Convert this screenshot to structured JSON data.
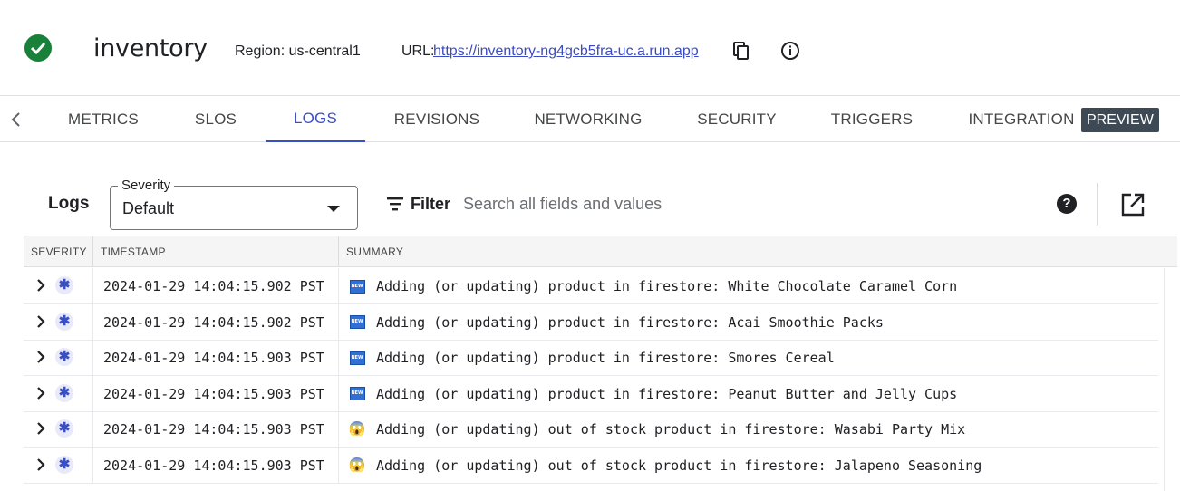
{
  "header": {
    "service_name": "inventory",
    "region": "Region: us-central1",
    "url_label": "URL:",
    "url": " https://inventory-ng4gcb5fra-uc.a.run.app ",
    "status": "healthy"
  },
  "tabs": [
    {
      "label": "METRICS"
    },
    {
      "label": "SLOS"
    },
    {
      "label": "LOGS",
      "active": true
    },
    {
      "label": "REVISIONS"
    },
    {
      "label": "NETWORKING"
    },
    {
      "label": "SECURITY"
    },
    {
      "label": "TRIGGERS"
    },
    {
      "label": "INTEGRATION"
    }
  ],
  "preview_badge": "PREVIEW",
  "logs": {
    "title": "Logs",
    "severity_label": "Severity",
    "severity_value": "Default",
    "filter_label": "Filter",
    "search_placeholder": "Search all fields and values",
    "help_glyph": "?"
  },
  "table": {
    "headers": [
      "SEVERITY",
      "TIMESTAMP",
      "SUMMARY"
    ],
    "rows": [
      {
        "timestamp": "2024-01-29 14:04:15.902 PST",
        "icon": "new-icon",
        "summary": "Adding (or updating) product in firestore: White Chocolate Caramel Corn"
      },
      {
        "timestamp": "2024-01-29 14:04:15.902 PST",
        "icon": "new-icon",
        "summary": "Adding (or updating) product in firestore: Acai Smoothie Packs"
      },
      {
        "timestamp": "2024-01-29 14:04:15.903 PST",
        "icon": "new-icon",
        "summary": "Adding (or updating) product in firestore: Smores Cereal"
      },
      {
        "timestamp": "2024-01-29 14:04:15.903 PST",
        "icon": "new-icon",
        "summary": "Adding (or updating) product in firestore: Peanut Butter and Jelly Cups"
      },
      {
        "timestamp": "2024-01-29 14:04:15.903 PST",
        "icon": "scream-icon",
        "summary": "Adding (or updating) out of stock product in firestore: Wasabi Party Mix"
      },
      {
        "timestamp": "2024-01-29 14:04:15.903 PST",
        "icon": "scream-icon",
        "summary": "Adding (or updating) out of stock product in firestore: Jalapeno Seasoning"
      }
    ]
  },
  "icons": {
    "new_glyph": "NEW",
    "scream_glyph": "😱",
    "severity_glyph": "✱"
  }
}
